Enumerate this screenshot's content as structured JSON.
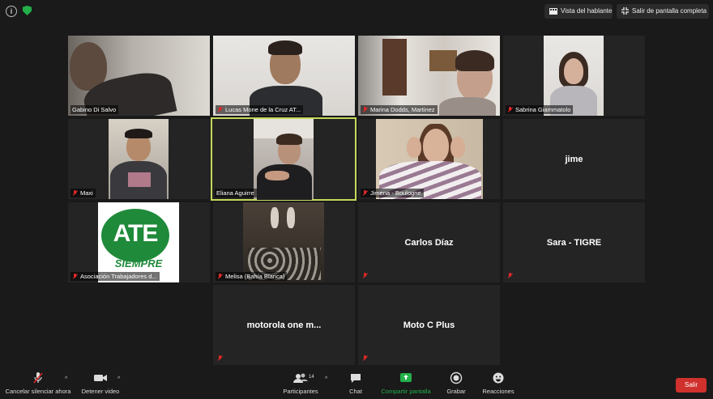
{
  "top_bar": {
    "speaker_view_label": "Vista del hablante",
    "exit_fullscreen_label": "Salir de pantalla completa"
  },
  "participants": [
    {
      "name": "Gabino Di Salvo",
      "muted": false,
      "video": true
    },
    {
      "name": "Lucas Mone de la Cruz AT...",
      "muted": true,
      "video": true
    },
    {
      "name": "Marina Dodds, Martinez",
      "muted": true,
      "video": true
    },
    {
      "name": "Sabrina Giammatolo",
      "muted": true,
      "video": true
    },
    {
      "name": "Maxi",
      "muted": true,
      "video": true
    },
    {
      "name": "Eliana Aguirre",
      "muted": false,
      "video": true,
      "active_speaker": true
    },
    {
      "name": "Jimena - Boulogne",
      "muted": true,
      "video": true
    },
    {
      "name": "jime",
      "muted": false,
      "video": false
    },
    {
      "name": "Asociación Trabajadores d...",
      "muted": true,
      "video": true,
      "logo_text": "ATE",
      "logo_subtext": "SIEMPRE"
    },
    {
      "name": "Melisa (Bahía Blanca)",
      "muted": true,
      "video": true
    },
    {
      "name": "Carlos Díaz",
      "muted": true,
      "video": false
    },
    {
      "name": "Sara - TIGRE",
      "muted": true,
      "video": false
    },
    {
      "name": "motorola one m...",
      "muted": true,
      "video": false
    },
    {
      "name": "Moto C Plus",
      "muted": true,
      "video": false
    }
  ],
  "toolbar": {
    "unmute_label": "Cancelar silenciar ahora",
    "stop_video_label": "Detener video",
    "participants_label": "Participantes",
    "participants_count": "14",
    "chat_label": "Chat",
    "share_label": "Compartir pantalla",
    "record_label": "Grabar",
    "reactions_label": "Reacciones",
    "leave_label": "Salir"
  },
  "colors": {
    "active_speaker_border": "#c4d95b",
    "share_green": "#23b04b",
    "leave_red": "#d0312d",
    "muted_red": "#e02828",
    "ate_green": "#1f8a3a"
  }
}
